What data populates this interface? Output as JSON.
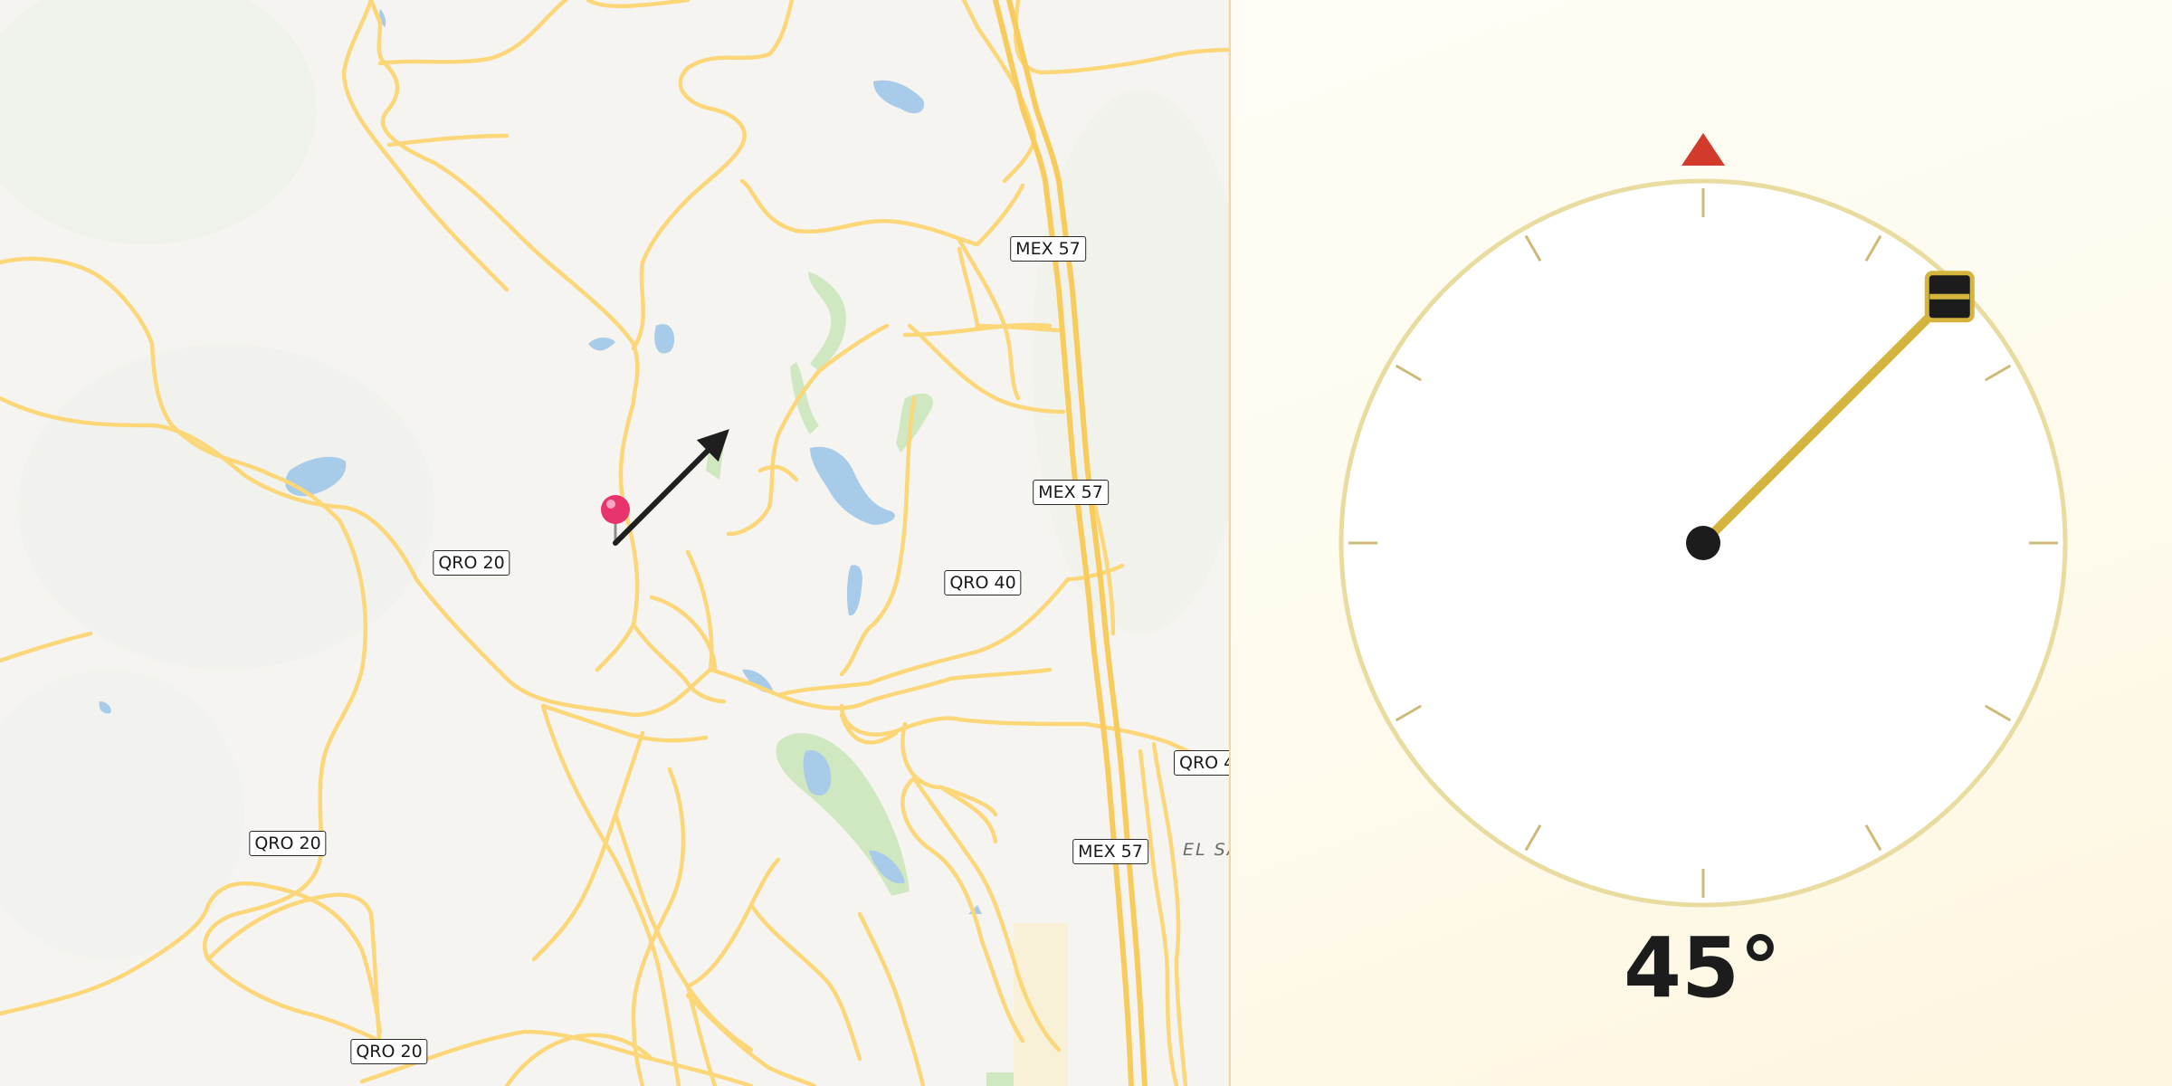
{
  "map": {
    "shields": [
      {
        "id": "mex57-a",
        "label": "MEX 57"
      },
      {
        "id": "mex57-b",
        "label": "MEX 57"
      },
      {
        "id": "mex57-c",
        "label": "MEX 57"
      },
      {
        "id": "qro20-a",
        "label": "QRO 20"
      },
      {
        "id": "qro20-b",
        "label": "QRO 20"
      },
      {
        "id": "qro20-c",
        "label": "QRO 20"
      },
      {
        "id": "qro40-a",
        "label": "QRO 40"
      },
      {
        "id": "qro40-b",
        "label": "QRO 4"
      }
    ],
    "place_label": "EL SA",
    "pin_color": "#e8336d",
    "direction_arrow_heading_deg": 45,
    "colors": {
      "road": "#fbd77a",
      "water": "#a7cbe8",
      "park": "#cfe8c2",
      "land": "#f6f4f0"
    }
  },
  "compass": {
    "heading_deg": 45,
    "heading_text": "45°",
    "north_marker_color": "#d23a2c",
    "needle_color": "#d4b43c",
    "ring_color": "#e8dca0"
  }
}
